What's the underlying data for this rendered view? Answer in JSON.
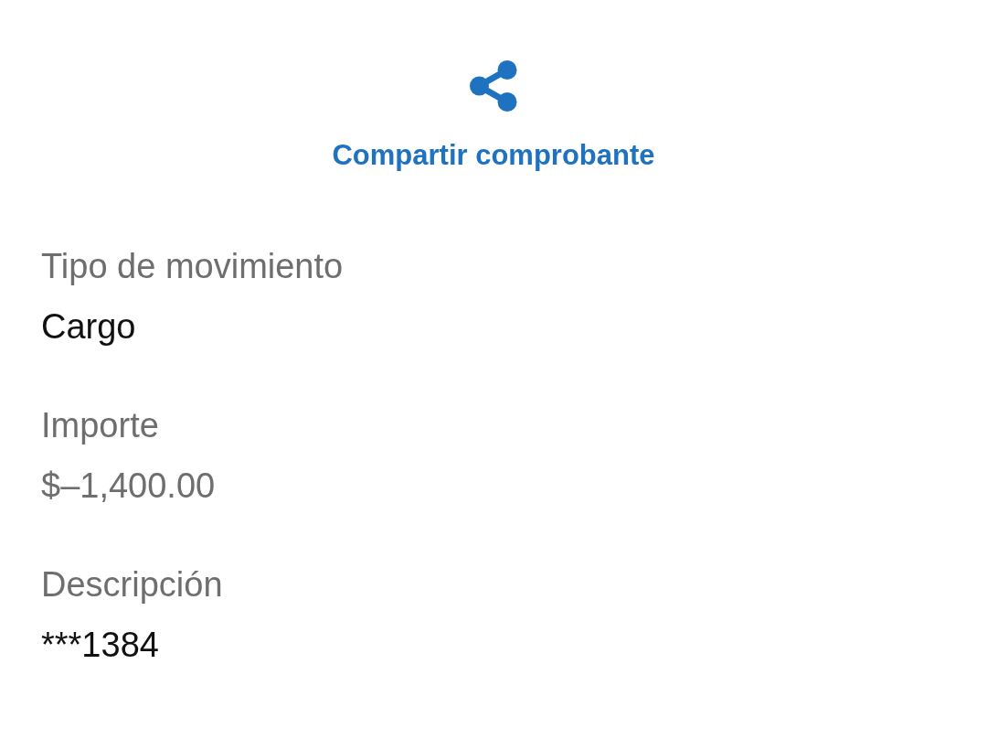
{
  "share": {
    "label": "Compartir comprobante"
  },
  "fields": [
    {
      "label": "Tipo de movimiento",
      "value": "Cargo",
      "muted": false
    },
    {
      "label": "Importe",
      "value": "$–1,400.00",
      "muted": true
    },
    {
      "label": "Descripción",
      "value": "***1384",
      "muted": false
    }
  ]
}
